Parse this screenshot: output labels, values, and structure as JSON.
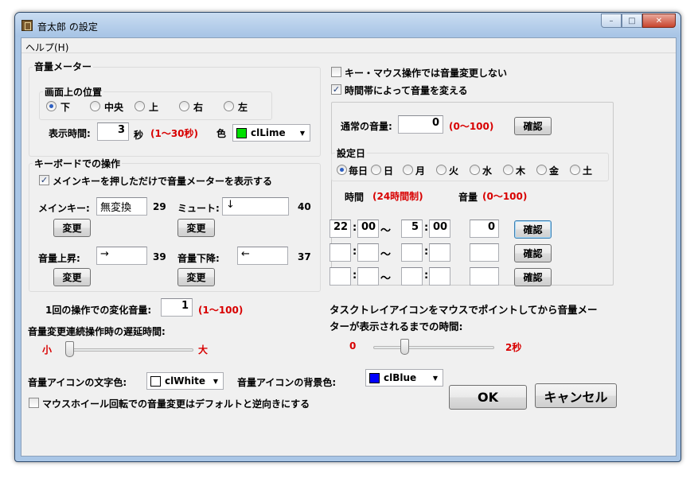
{
  "window": {
    "title": "音太郎 の設定",
    "minimize_glyph": "–",
    "maximize_glyph": "□",
    "close_glyph": "✕"
  },
  "menu": {
    "help": "ヘルプ(H)"
  },
  "meter": {
    "group_label": "音量メーター",
    "position_label": "画面上の位置",
    "positions": [
      "下",
      "中央",
      "上",
      "右",
      "左"
    ],
    "selected_position": "下",
    "display_time_label": "表示時間:",
    "display_time_value": "3",
    "display_time_unit": "秒",
    "display_time_range": "(1〜30秒)",
    "color_label": "色",
    "color_value": "clLime",
    "color_hex": "#00e000"
  },
  "keyboard": {
    "group_label": "キーボードでの操作",
    "show_meter_checkbox": "メインキーを押しただけで音量メーターを表示する",
    "show_meter_checked": true,
    "main_key_label": "メインキー:",
    "main_key_value": "無変換",
    "main_key_code": "29",
    "mute_label": "ミュート:",
    "mute_value": "↓",
    "mute_code": "40",
    "vol_up_label": "音量上昇:",
    "vol_up_value": "→",
    "vol_up_code": "39",
    "vol_down_label": "音量下降:",
    "vol_down_value": "←",
    "vol_down_code": "37",
    "change_button": "変更"
  },
  "step": {
    "label": "1回の操作での変化音量:",
    "value": "1",
    "range": "(1〜100)"
  },
  "delay": {
    "label": "音量変更連続操作時の遅延時間:",
    "min_label": "小",
    "max_label": "大",
    "level_fraction": 0.0
  },
  "icon_colors": {
    "text_color_label": "音量アイコンの文字色:",
    "text_color_value": "clWhite",
    "text_color_hex": "#ffffff",
    "bg_color_label": "音量アイコンの背景色:",
    "bg_color_value": "clBlue",
    "bg_color_hex": "#0000ff"
  },
  "wheel": {
    "label": "マウスホイール回転での音量変更はデフォルトと逆向きにする",
    "checked": false
  },
  "right": {
    "no_change_checkbox": "キー・マウス操作では音量変更しない",
    "no_change_checked": false,
    "by_time_checkbox": "時間帯によって音量を変える",
    "by_time_checked": true,
    "normal_volume_label": "通常の音量:",
    "normal_volume_value": "0",
    "normal_volume_range": "(0〜100)",
    "confirm_button": "確認",
    "days_label": "設定日",
    "days": [
      "毎日",
      "日",
      "月",
      "火",
      "水",
      "木",
      "金",
      "土"
    ],
    "selected_day": "毎日",
    "time_header": "時間",
    "time_header_note": "(24時間制)",
    "volume_header": "音量",
    "volume_header_note": "(0〜100)",
    "rows": [
      {
        "start_h": "22",
        "start_m": "00",
        "end_h": "5",
        "end_m": "00",
        "volume": "0"
      },
      {
        "start_h": "",
        "start_m": "",
        "end_h": "",
        "end_m": "",
        "volume": ""
      },
      {
        "start_h": "",
        "start_m": "",
        "end_h": "",
        "end_m": "",
        "volume": ""
      }
    ],
    "colon": ":",
    "tilde": "〜"
  },
  "tray": {
    "label_line1": "タスクトレイアイコンをマウスでポイントしてから音量メー",
    "label_line2": "ターが表示されるまでの時間:",
    "min_label": "0",
    "max_label": "2秒",
    "level_fraction": 0.25
  },
  "buttons": {
    "ok": "OK",
    "cancel": "キャンセル"
  }
}
